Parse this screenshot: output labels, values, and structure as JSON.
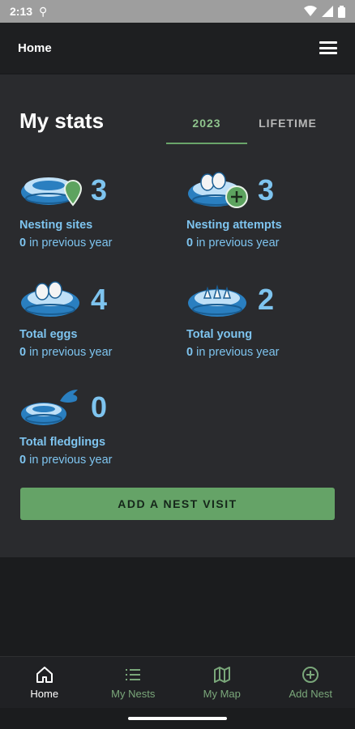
{
  "status": {
    "time": "2:13"
  },
  "app_bar": {
    "title": "Home"
  },
  "stats": {
    "title": "My stats",
    "tabs": [
      {
        "label": "2023",
        "active": true
      },
      {
        "label": "LIFETIME",
        "active": false
      }
    ],
    "items": [
      {
        "icon": "nest-pin-icon",
        "value": "3",
        "label": "Nesting sites",
        "prev_count": "0",
        "prev_text": " in previous year"
      },
      {
        "icon": "nest-eggs-plus-icon",
        "value": "3",
        "label": "Nesting attempts",
        "prev_count": "0",
        "prev_text": " in previous year"
      },
      {
        "icon": "nest-eggs-icon",
        "value": "4",
        "label": "Total eggs",
        "prev_count": "0",
        "prev_text": " in previous year"
      },
      {
        "icon": "nest-young-icon",
        "value": "2",
        "label": "Total young",
        "prev_count": "0",
        "prev_text": " in previous year"
      },
      {
        "icon": "nest-fledgling-icon",
        "value": "0",
        "label": "Total fledglings",
        "prev_count": "0",
        "prev_text": " in previous year"
      }
    ],
    "add_button": "ADD A NEST VISIT"
  },
  "nav": [
    {
      "label": "Home",
      "icon": "home-icon",
      "active": true
    },
    {
      "label": "My Nests",
      "icon": "list-icon",
      "active": false
    },
    {
      "label": "My Map",
      "icon": "map-icon",
      "active": false
    },
    {
      "label": "Add Nest",
      "icon": "add-circle-icon",
      "active": false
    }
  ],
  "colors": {
    "accent": "#65a367",
    "stat_blue": "#7ec4ef",
    "nest_blue": "#2a7fc0"
  }
}
